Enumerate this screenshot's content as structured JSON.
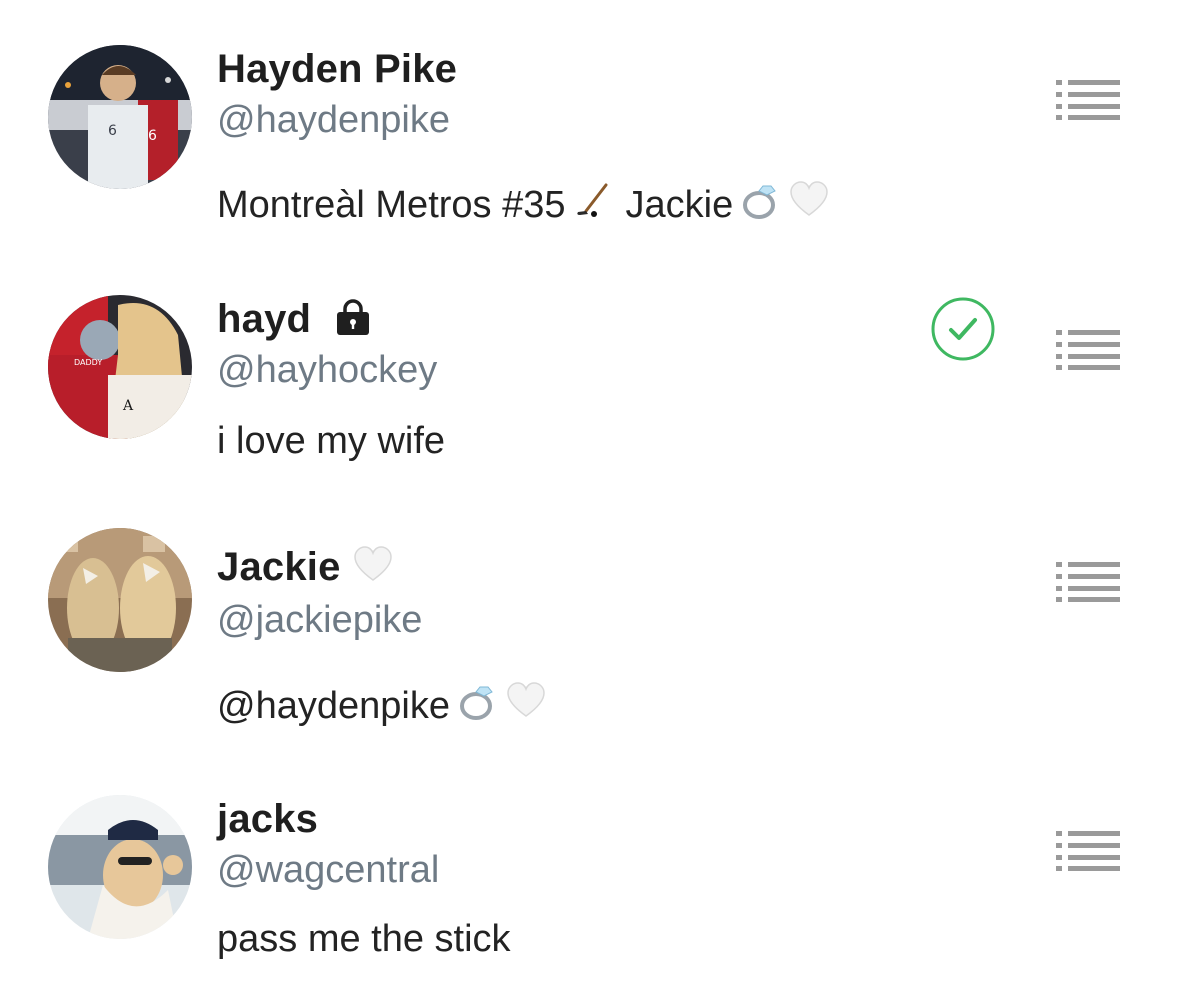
{
  "users": [
    {
      "display_name": "Hayden Pike",
      "handle": "@haydenpike",
      "bio_text_1": "Montreàl Metros #35",
      "bio_text_2": "Jackie",
      "bio_icons": [
        "hockey-stick-icon",
        "ring-icon",
        "white-heart-icon"
      ]
    },
    {
      "display_name": "hayd",
      "handle": "@hayhockey",
      "bio_text_1": "i love my wife",
      "name_icon": "lock-icon",
      "status_icon": "checkmark-circle-icon"
    },
    {
      "display_name": "Jackie",
      "handle": "@jackiepike",
      "bio_text_1": "@haydenpike",
      "name_icon": "white-heart-icon",
      "bio_icons": [
        "ring-icon",
        "white-heart-icon"
      ]
    },
    {
      "display_name": "jacks",
      "handle": "@wagcentral",
      "bio_text_1": "pass me the stick"
    }
  ],
  "colors": {
    "name": "#1f1f1f",
    "handle": "#6e7a85",
    "menu_icon": "#9a9a9a",
    "check_green": "#3fb861",
    "lock": "#1f1f1f"
  }
}
